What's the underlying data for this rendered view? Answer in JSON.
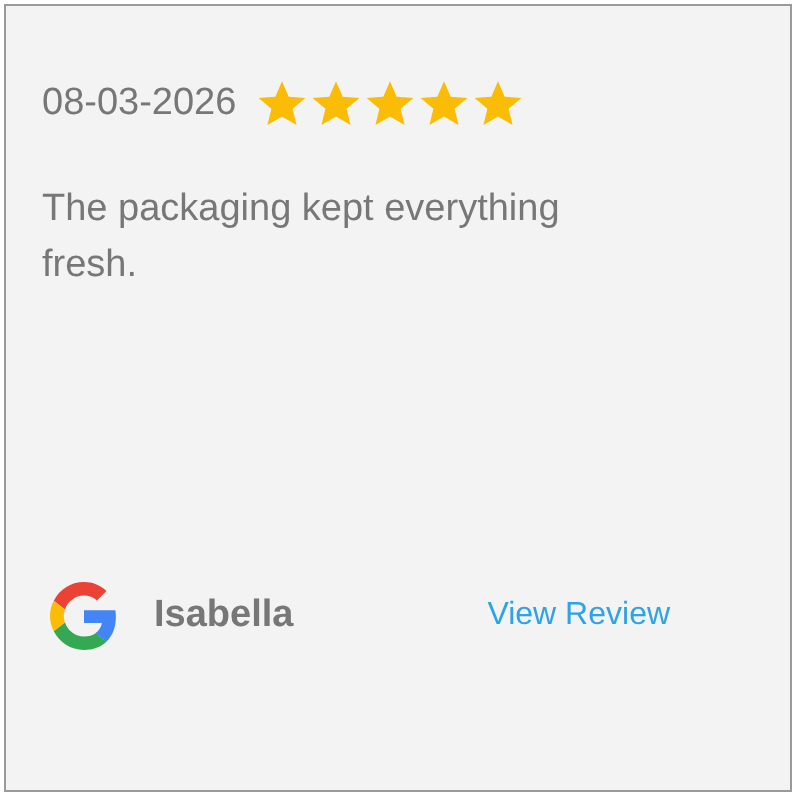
{
  "review": {
    "date": "08-03-2026",
    "stars": 5,
    "text": "The packaging kept everything fresh.",
    "author": "Isabella",
    "link": "View Review"
  }
}
